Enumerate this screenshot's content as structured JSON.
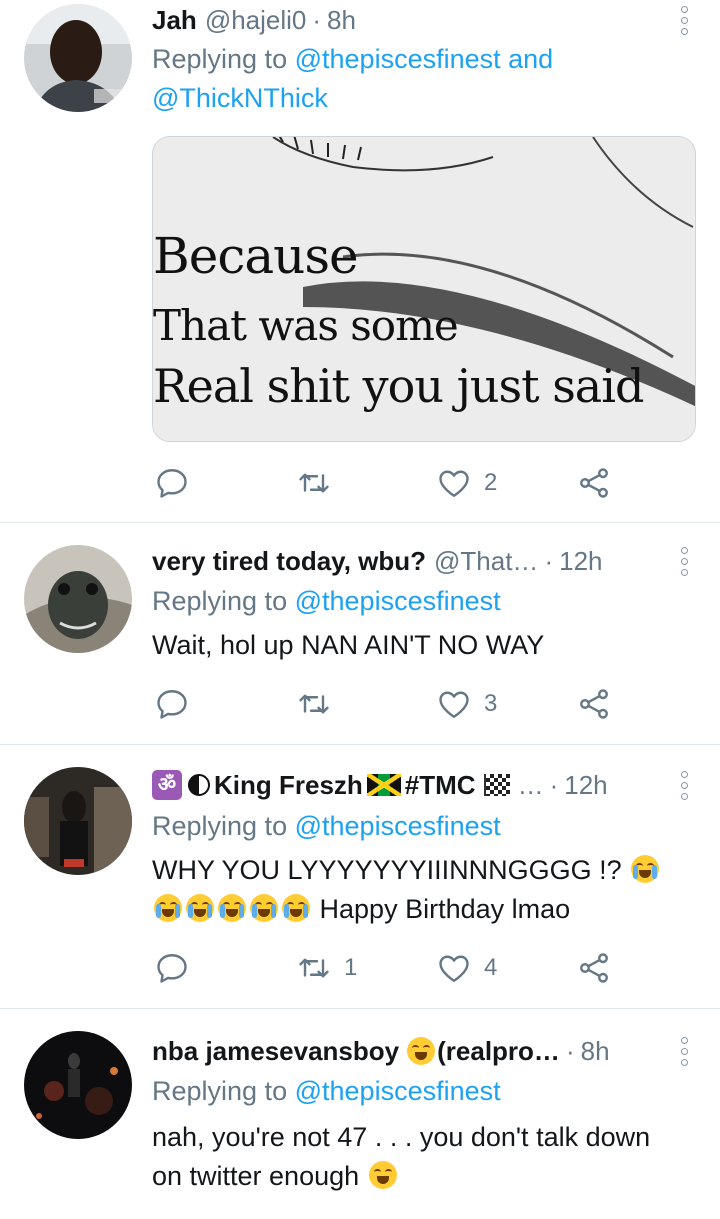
{
  "tweets": [
    {
      "name": "Jah",
      "handle": "@hajeli0",
      "time": "8h",
      "replying_prefix": "Replying to",
      "replying_mentions": "@thepiscesfinest and @ThickNThick",
      "text": "",
      "media_lines": [
        "Because",
        "That was some",
        "Real shit you just said"
      ],
      "retweets": "",
      "likes": "2"
    },
    {
      "name": "very tired today, wbu?",
      "handle": "@That…",
      "time": "12h",
      "replying_prefix": "Replying to",
      "replying_mentions": "@thepiscesfinest",
      "text": "Wait, hol up NAN AIN'T NO WAY",
      "retweets": "",
      "likes": "3"
    },
    {
      "name_text": "King Freszh",
      "name_tag": "#TMC",
      "handle": "…",
      "time": "12h",
      "replying_prefix": "Replying to",
      "replying_mentions": "@thepiscesfinest",
      "text_line1": "WHY YOU LYYYYYYYIIINNNGGGG !?",
      "text_line2": "Happy Birthday lmao",
      "retweets": "1",
      "likes": "4"
    },
    {
      "name": "nba jamesevansboy",
      "name_suffix": "(realpro…",
      "time": "8h",
      "replying_prefix": "Replying to",
      "replying_mentions": "@thepiscesfinest",
      "text_line1": "nah, you're not 47 . . . you don't talk down",
      "text_line2": "on twitter enough"
    }
  ],
  "colors": {
    "accent": "#1da1f2",
    "secondary_text": "#657786",
    "divider": "#e1e8ed"
  },
  "icons": [
    "reply-icon",
    "retweet-icon",
    "like-icon",
    "share-icon",
    "more-options-icon"
  ]
}
